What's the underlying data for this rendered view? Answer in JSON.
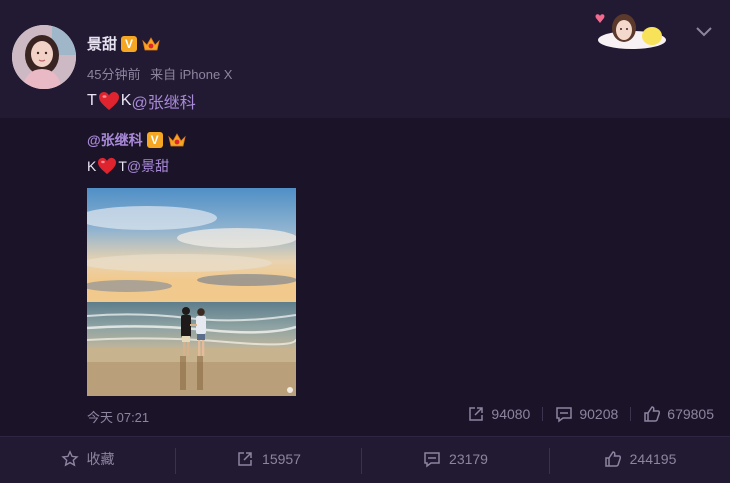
{
  "post": {
    "author": "景甜",
    "verified_badge": "V",
    "meta_time": "45分钟前",
    "meta_source": "来自 iPhone X",
    "text_prefix": "T",
    "text_mid": "K",
    "mention": "@张继科"
  },
  "repost": {
    "author": "@张继科",
    "verified_badge": "V",
    "text_prefix": "K",
    "text_mid": "T",
    "mention": "@景甜",
    "time": "今天 07:21",
    "stats": {
      "reposts": "94080",
      "comments": "90208",
      "likes": "679805"
    }
  },
  "actions": {
    "favorite": "收藏",
    "repost": "15957",
    "comment": "23179",
    "like": "244195"
  },
  "icons": {
    "avatar": "avatar-photo",
    "verified": "verified-v-icon",
    "member": "crown-member-icon",
    "heart": "heart-emoji-icon",
    "chevron": "chevron-down-icon",
    "repost": "repost-icon",
    "comment": "comment-icon",
    "like": "thumbs-up-icon",
    "favorite": "star-icon"
  },
  "colors": {
    "background": "#221a33",
    "repost_bg": "#1b1429",
    "mention": "#a98ad8",
    "muted": "#8d849f",
    "heart": "#e0242f",
    "badge": "#f5a623"
  }
}
